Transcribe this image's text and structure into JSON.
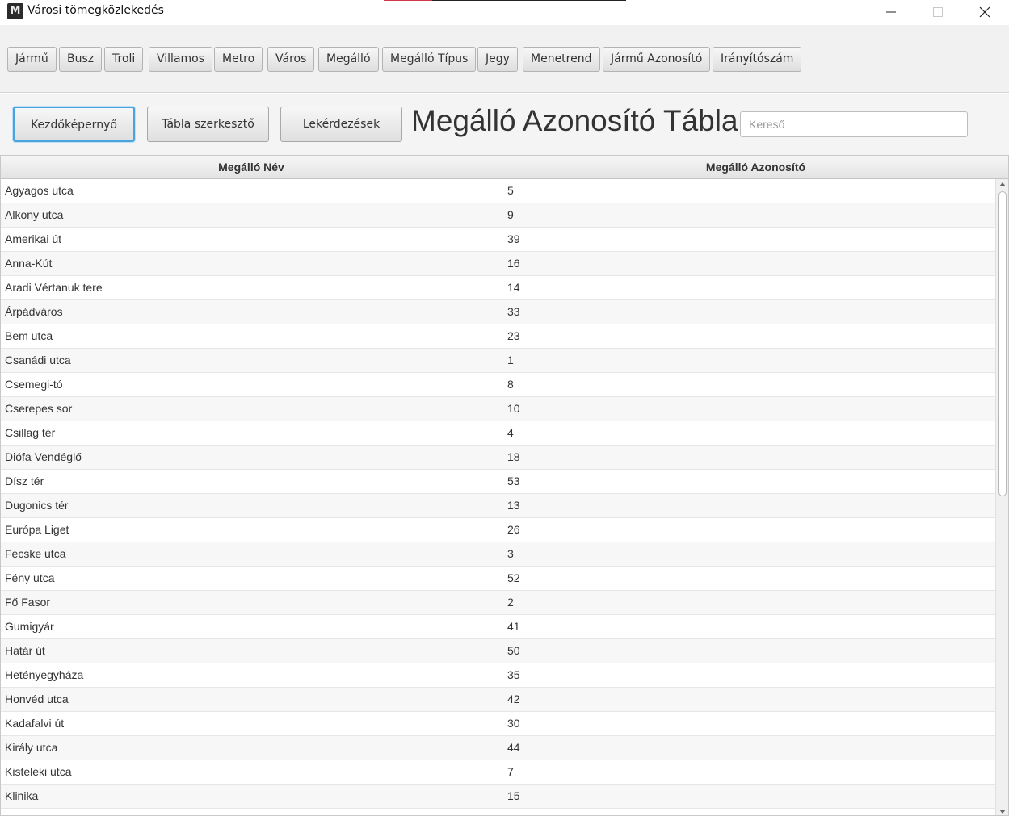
{
  "window": {
    "title": "Városi tömegközlekedés",
    "icon_letter": "M",
    "controls": [
      "minimize-icon",
      "maximize-icon",
      "close-icon"
    ]
  },
  "tables_bar": {
    "buttons": [
      "Jármű",
      "Busz",
      "Troli",
      "Villamos",
      "Metro",
      "Város",
      "Megálló",
      "Megálló Típus",
      "Jegy",
      "Menetrend",
      "Jármű Azonosító",
      "Irányítószám"
    ]
  },
  "toolbar": {
    "home_label": "Kezdőképernyő",
    "editor_label": "Tábla szerkesztő",
    "queries_label": "Lekérdezések",
    "page_title": "Megálló Azonosító Tábla",
    "search_placeholder": "Kereső",
    "search_value": ""
  },
  "table": {
    "columns": [
      "Megálló Név",
      "Megálló Azonosító"
    ],
    "rows": [
      [
        "Agyagos utca",
        "5"
      ],
      [
        "Alkony utca",
        "9"
      ],
      [
        "Amerikai út",
        "39"
      ],
      [
        "Anna-Kút",
        "16"
      ],
      [
        "Aradi Vértanuk tere",
        "14"
      ],
      [
        "Árpádváros",
        "33"
      ],
      [
        "Bem utca",
        "23"
      ],
      [
        "Csanádi utca",
        "1"
      ],
      [
        "Csemegi-tó",
        "8"
      ],
      [
        "Cserepes sor",
        "10"
      ],
      [
        "Csillag tér",
        "4"
      ],
      [
        "Diófa Vendéglő",
        "18"
      ],
      [
        "Dísz tér",
        "53"
      ],
      [
        "Dugonics tér",
        "13"
      ],
      [
        "Európa Liget",
        "26"
      ],
      [
        "Fecske utca",
        "3"
      ],
      [
        "Fény utca",
        "52"
      ],
      [
        "Fő Fasor",
        "2"
      ],
      [
        "Gumigyár",
        "41"
      ],
      [
        "Határ út",
        "50"
      ],
      [
        "Hetényegyháza",
        "35"
      ],
      [
        "Honvéd utca",
        "42"
      ],
      [
        "Kadafalvi út",
        "30"
      ],
      [
        "Király utca",
        "44"
      ],
      [
        "Kisteleki utca",
        "7"
      ],
      [
        "Klinika",
        "15"
      ]
    ]
  },
  "colors": {
    "focus_accent": "#4aa3df",
    "title_accent": "#d0354a"
  }
}
